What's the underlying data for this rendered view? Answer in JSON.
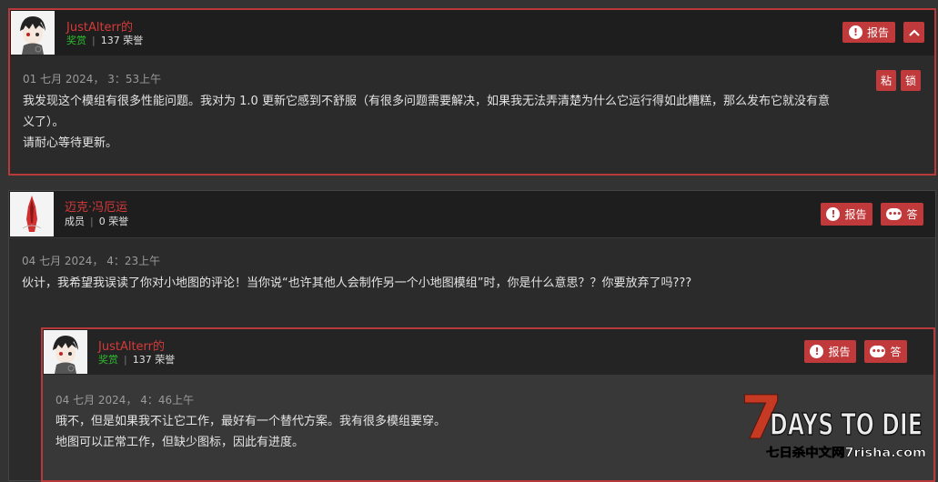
{
  "posts": [
    {
      "username": "JustAlterr的",
      "rank": "奖赏",
      "honor": "137 荣誉",
      "report_label": "报告",
      "date": "01 七月 2024， 3：53上午",
      "sticky_label": "粘",
      "lock_label": "锁",
      "lines": [
        "我发现这个模组有很多性能问题。我对为 1.0 更新它感到不舒服（有很多问题需要解决，如果我无法弄清楚为什么它运行得如此糟糕，那么发布它就没有意",
        "义了）。",
        "请耐心等待更新。"
      ]
    },
    {
      "username": "迈克·冯厄运",
      "rank": "成员",
      "honor": "0 荣誉",
      "report_label": "报告",
      "reply_label": "答",
      "date": "04 七月 2024， 4：23上午",
      "lines": [
        "伙计，我希望我误读了你对小地图的评论！当你说“也许其他人会制作另一个小地图模组”时，你是什么意思？？你要放弃了吗???"
      ]
    },
    {
      "username": "JustAlterr的",
      "rank": "奖赏",
      "honor": "137 荣誉",
      "report_label": "报告",
      "reply_label": "答",
      "date": "04 七月 2024， 4：46上午",
      "lines": [
        "哦不，但是如果我不让它工作，最好有一个替代方案。我有很多模组要穿。",
        "地图可以正常工作，但缺少图标，因此有进度。"
      ]
    }
  ],
  "watermark": {
    "logo_number": "7",
    "logo_text": "DAYS TO DIE",
    "site_text": "七日杀中文网7risha.com"
  },
  "icons": {
    "report": "alert-circle-icon",
    "reply": "speech-bubble-icon",
    "collapse": "chevron-up-icon"
  },
  "colors": {
    "accent": "#c0393b",
    "username": "#d63a3a",
    "rank_green": "#2eb82e",
    "background": "#333333"
  }
}
